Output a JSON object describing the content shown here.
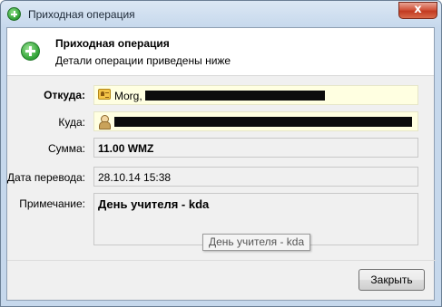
{
  "window": {
    "title": "Приходная операция",
    "close_glyph": "x"
  },
  "header": {
    "title": "Приходная операция",
    "subtitle": "Детали операции приведены ниже"
  },
  "fields": {
    "from": {
      "label": "Откуда:",
      "value": "Morg,",
      "icon": "passport-icon"
    },
    "to": {
      "label": "Куда:",
      "icon": "person-icon"
    },
    "amount": {
      "label": "Сумма:",
      "value": "11.00 WMZ"
    },
    "date": {
      "label": "Дата перевода:",
      "value": "28.10.14 15:38"
    },
    "note": {
      "label": "Примечание:",
      "value": "День учителя - kda"
    }
  },
  "tooltip": {
    "text": "День учителя - kda"
  },
  "buttons": {
    "close_label": "Закрыть"
  },
  "colors": {
    "highlight_field": "#ffffe1",
    "icon_green": "#36a63b"
  }
}
